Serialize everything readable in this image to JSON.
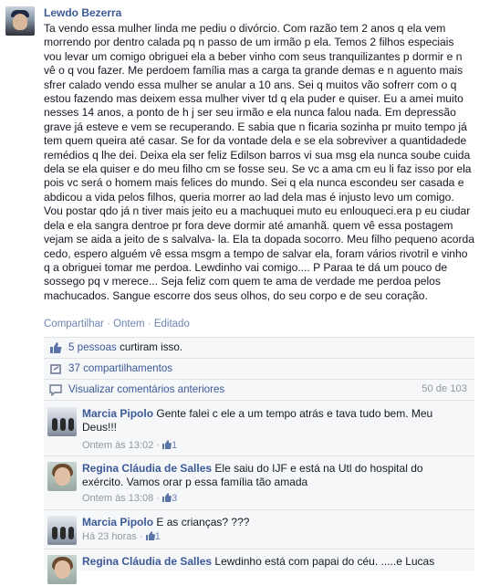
{
  "post": {
    "author": "Lewdo Bezerra",
    "text": "Ta vendo essa mulher linda me pediu o divórcio. Com razão tem 2 anos q ela vem morrendo por dentro calada pq n passo de um irmão p ela. Temos 2 filhos especiais vou levar um comigo obriguei ela a beber vinho com seus tranquilizantes p dormir e n vê o q vou fazer. Me perdoem família mas a carga ta grande demas e n aguento mais sfrer calado vendo essa mulher se anular a 10 ans. Sei q muitos vão sofrerr com o q estou fazendo mas deixem essa mulher viver td q ela puder e quiser. Eu a amei muito nesses 14 anos, a ponto de h j ser seu irmão e ela nunca falou nada. Em depressão grave já esteve e vem se recuperando. E sabia que n ficaria sozinha pr muito tempo já tem quem queira até casar. Se for da vontade dela e se ela sobreviver a quantidadede remédios q lhe dei. Deixa ela ser feliz Edilson barros vi sua msg ela nunca soube cuida dela se ela quiser e do meu filho cm se fosse seu. Se vc a ama cm eu li faz isso por ela pois vc será o homem mais felices do mundo. Sei q ela nunca escondeu ser casada e abdicou a vida pelos filhos, queria morrer ao lad dela mas é injusto levo um comigo. Vou postar qdo já n tiver mais jeito eu a machuquei muto eu enlouqueci.era p eu ciudar dela e ela sangra dentroe pr fora deve dormir até amanhã. quem vê essa postagem vejam se aida a jeito de s salvalva- la. Ela ta dopada socorro. Meu filho pequeno acorda cedo, espero alguém vê essa msgm a tempo de salvar ela, foram vários rivotril e vinho q a obriguei tomar me perdoa. Lewdinho vai comigo.... P Paraa te dá um pouco de sossego pq v merece... Seja feliz com quem te ama de verdade me perdoa pelos machucados. Sangue escorre dos seus olhos, do seu corpo e de seu coração.",
    "actions": {
      "share": "Compartilhar",
      "sep": "·",
      "time": "Ontem",
      "edited": "Editado"
    }
  },
  "feedback": {
    "likes_link": "5 pessoas",
    "likes_suffix": " curtiram isso.",
    "shares": "37 compartilhamentos",
    "view_previous": "Visualizar comentários anteriores",
    "count": "50 de 103"
  },
  "comments": [
    {
      "author": "Marcia Pipolo",
      "text": "Gente falei c ele a um tempo atrás e tava tudo bem. Meu Deus!!!",
      "time": "Ontem às 13:02",
      "likes": "1",
      "avatar": "marcia"
    },
    {
      "author": "Regina Cláudia de Salles",
      "text": "Ele saiu do IJF e está na Utl do hospital do exército. Vamos orar p essa família tão amada",
      "time": "Ontem às 13:08",
      "likes": "3",
      "avatar": "regina"
    },
    {
      "author": "Marcia Pipolo",
      "text": "E as crianças? ???",
      "time": "Há 23 horas",
      "likes": "1",
      "avatar": "marcia"
    },
    {
      "author": "Regina Cláudia de Salles",
      "text": "Lewdinho está com papai do céu. .....e Lucas",
      "time": "",
      "likes": "",
      "avatar": "regina"
    }
  ],
  "colors": {
    "link": "#3b5998",
    "meta": "#9197a3",
    "feedback_bg": "#f6f7f9"
  }
}
